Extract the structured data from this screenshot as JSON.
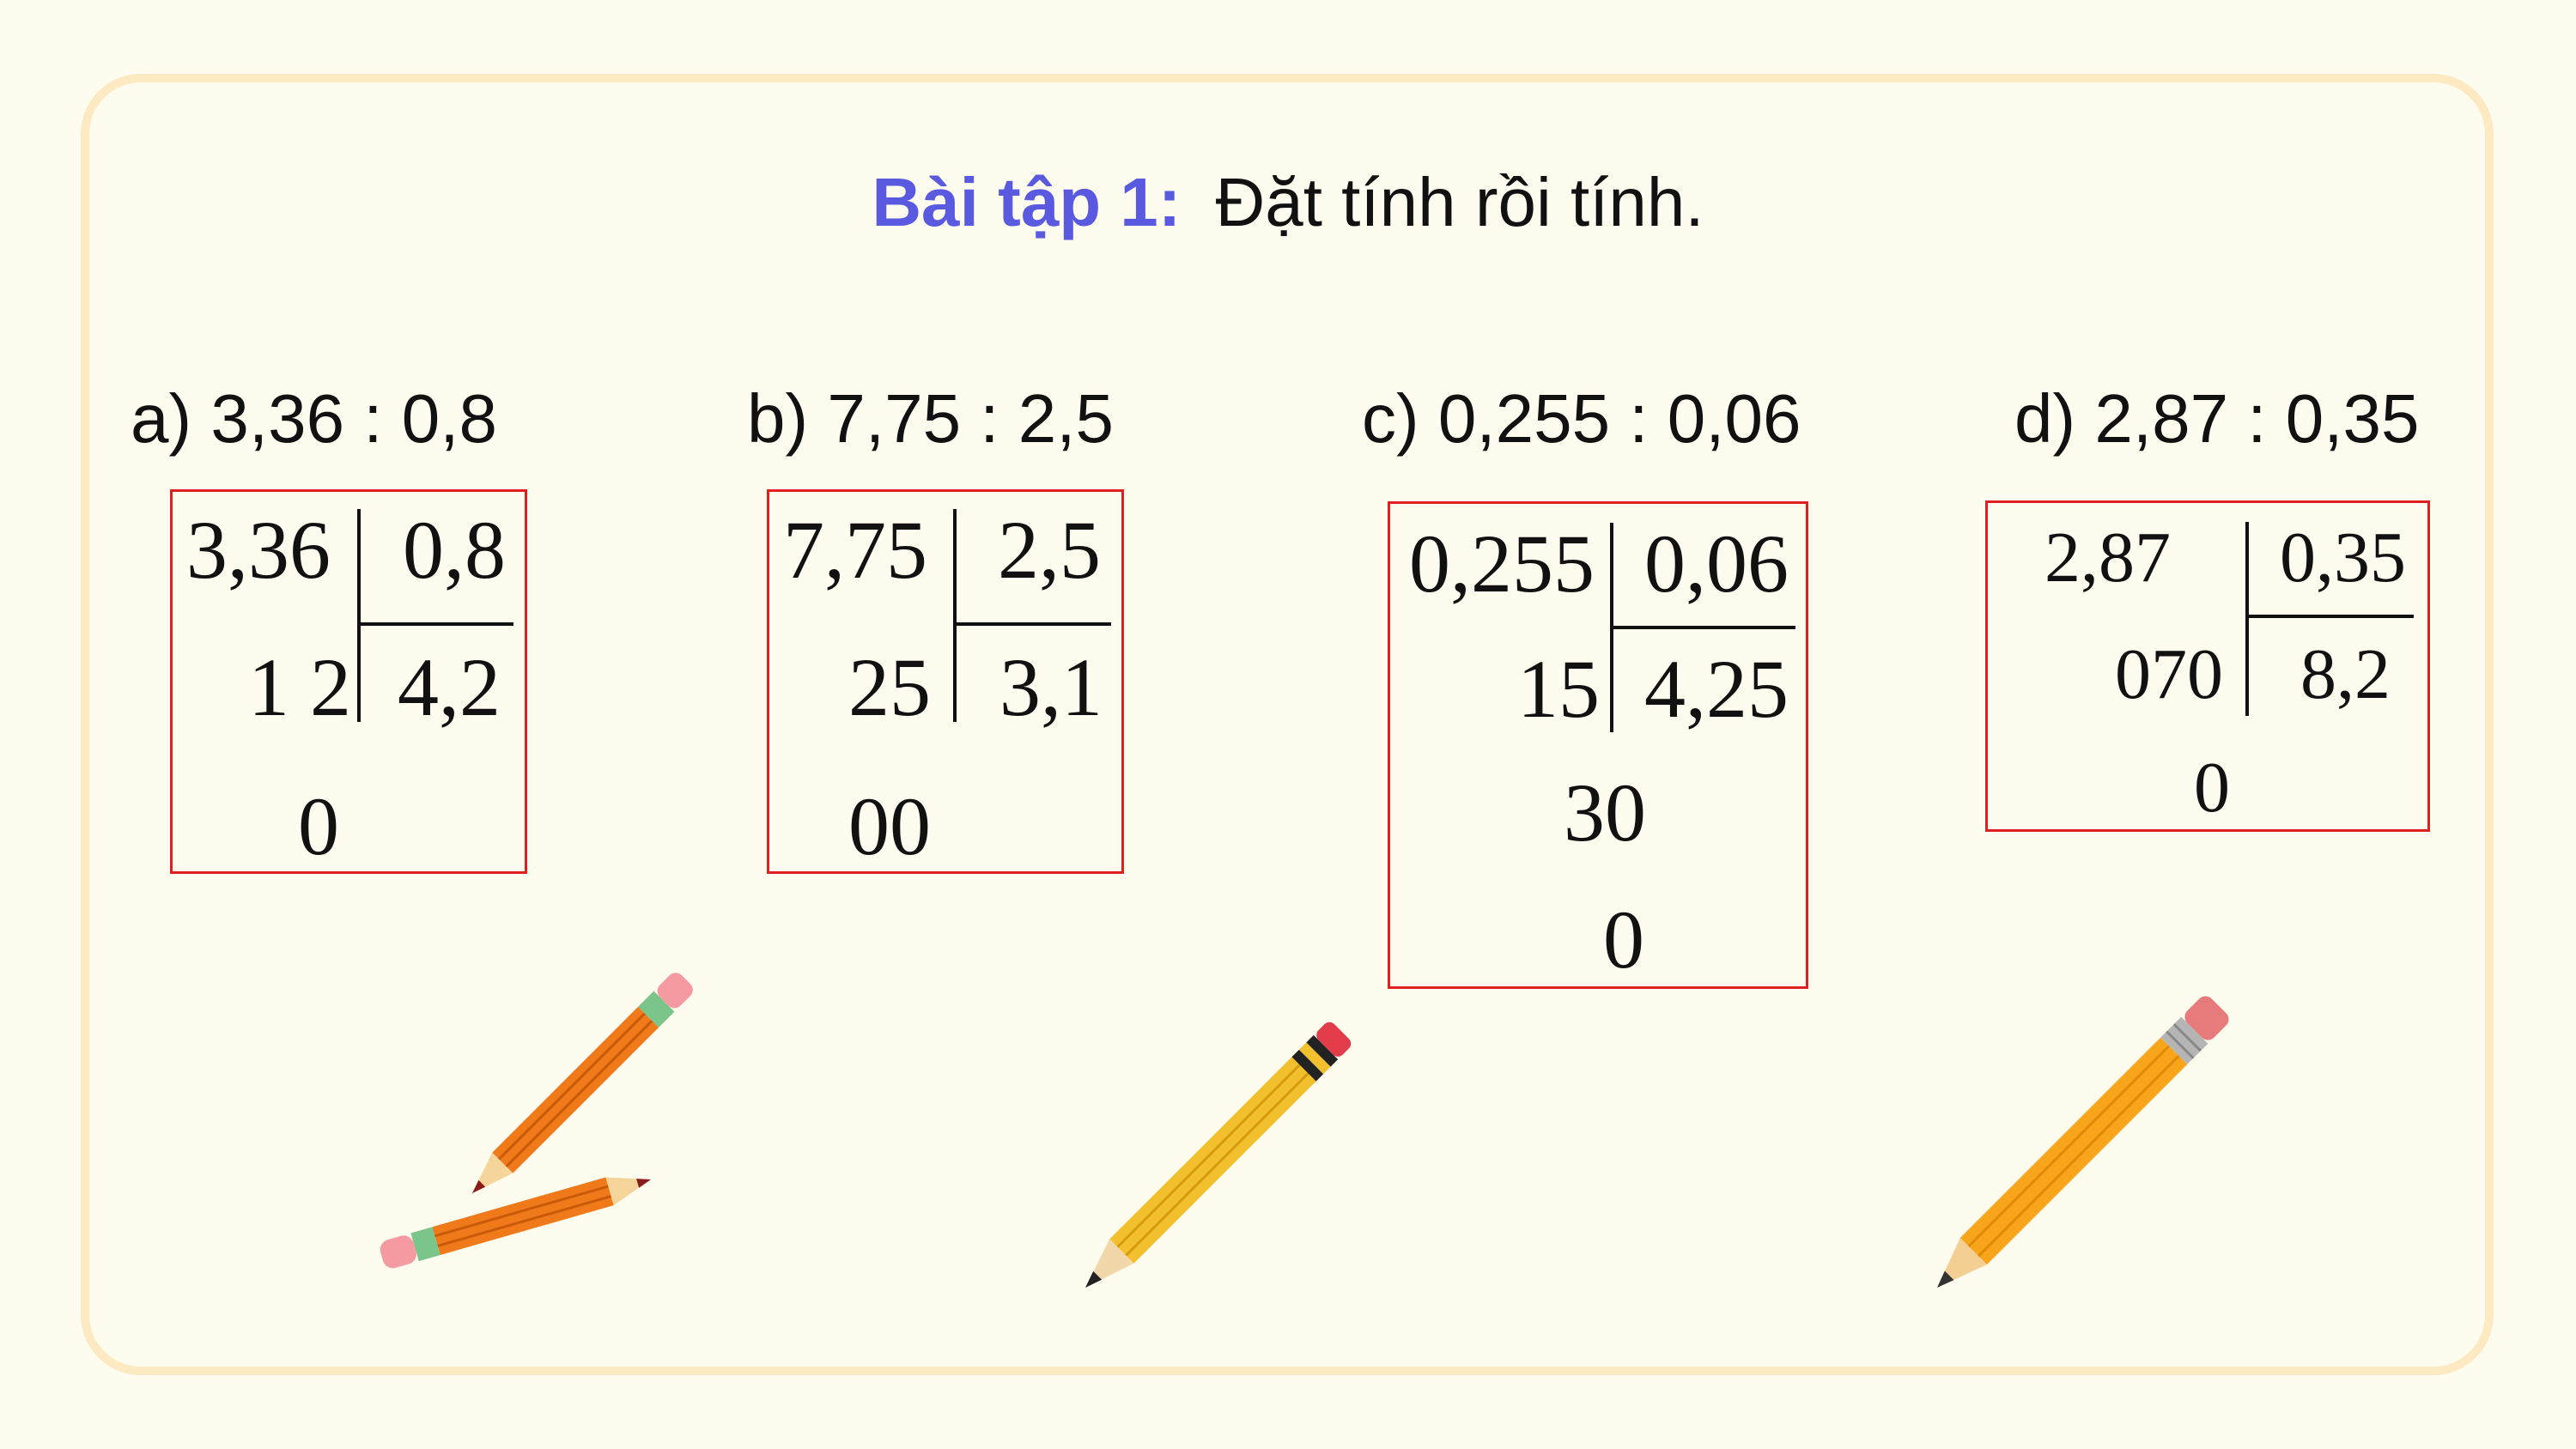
{
  "title": {
    "label": "Bài tập 1:",
    "text": "Đặt tính rồi tính."
  },
  "problems": [
    {
      "label": "a) 3,36 : 0,8",
      "dividend": "3,36",
      "divisor": "0,8",
      "rem1": "1 2",
      "quotient": "4,2",
      "rem2": "0"
    },
    {
      "label": "b) 7,75 : 2,5",
      "dividend": "7,75",
      "divisor": "2,5",
      "rem1": "25",
      "quotient": "3,1",
      "rem2": "00"
    },
    {
      "label": "c) 0,255 : 0,06",
      "dividend": "0,255",
      "divisor": "0,06",
      "rem1": "15",
      "quotient": "4,25",
      "rem2": "30",
      "rem3": "0"
    },
    {
      "label": "d) 2,87 : 0,35",
      "dividend": "2,87",
      "divisor": "0,35",
      "rem1": "070",
      "quotient": "8,2",
      "rem2": "0"
    }
  ],
  "colors": {
    "background": "#fefcef",
    "frame": "#fde9c2",
    "title_label": "#5a5ae0",
    "box_border": "#e02020"
  },
  "icons": [
    "pencil-pair-icon",
    "yellow-pencil-icon",
    "orange-pencil-icon"
  ]
}
